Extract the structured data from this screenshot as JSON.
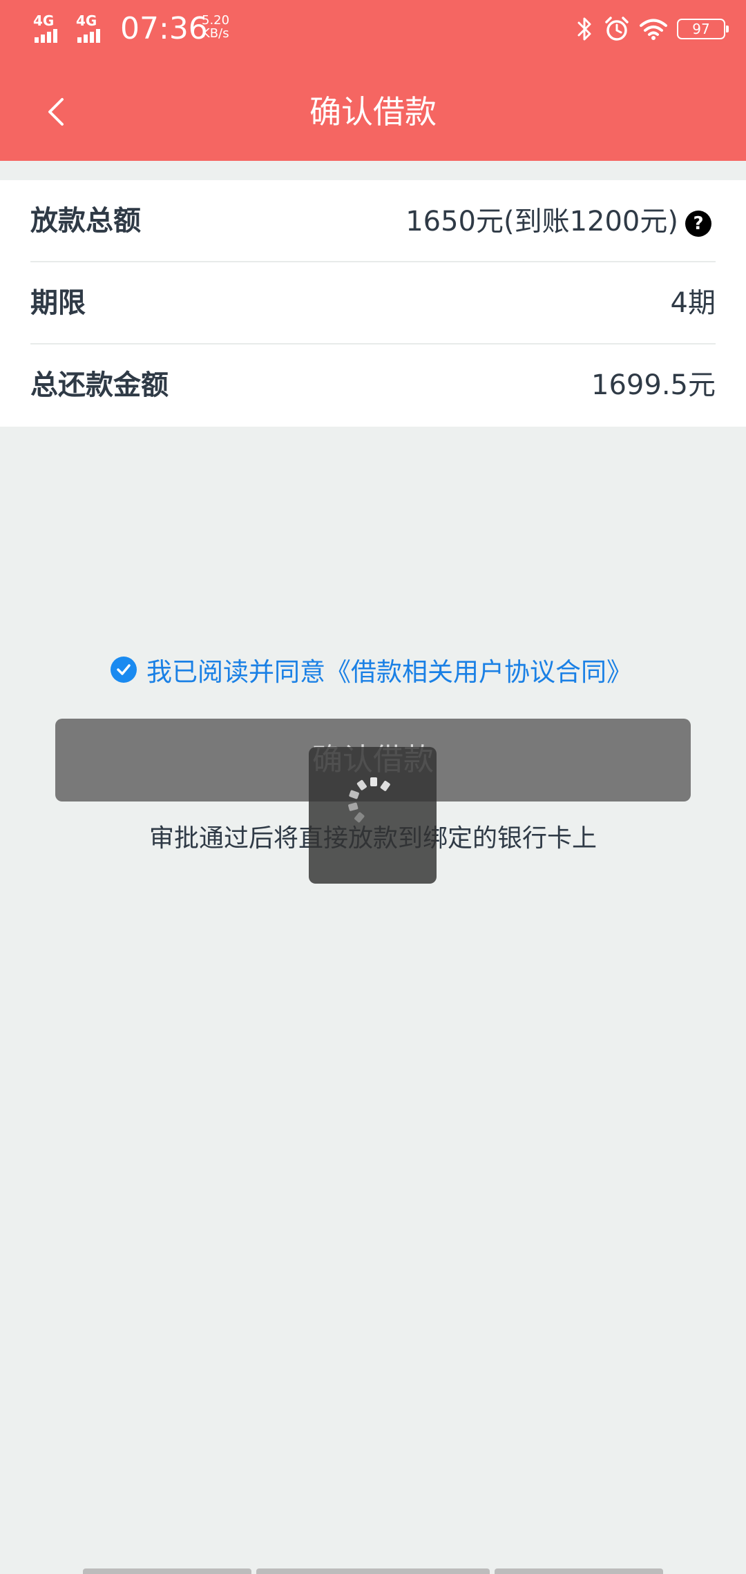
{
  "status_bar": {
    "network_1": "4G",
    "network_2": "4G",
    "time": "07:36",
    "speed_value": "5.20",
    "speed_unit": "KB/s",
    "battery": "97",
    "icons": [
      "bluetooth-icon",
      "alarm-icon",
      "wifi-icon",
      "battery-icon"
    ]
  },
  "header": {
    "title": "确认借款",
    "back_icon": "back-arrow-icon",
    "color": "#f56662"
  },
  "loan_info": {
    "rows": [
      {
        "label": "放款总额",
        "value": "1650元(到账1200元)",
        "help": "?"
      },
      {
        "label": "期限",
        "value": "4期"
      },
      {
        "label": "总还款金额",
        "value": "1699.5元"
      }
    ]
  },
  "agreement": {
    "checked": true,
    "prefix": "我已阅读并同意",
    "link_text": "《借款相关用户协议合同》",
    "color": "#1a80e5"
  },
  "confirm_button": {
    "label": "确认借款"
  },
  "tip": "审批通过后将直接放款到绑定的银行卡上",
  "loading": {
    "visible": true,
    "icon": "spinner-icon"
  }
}
